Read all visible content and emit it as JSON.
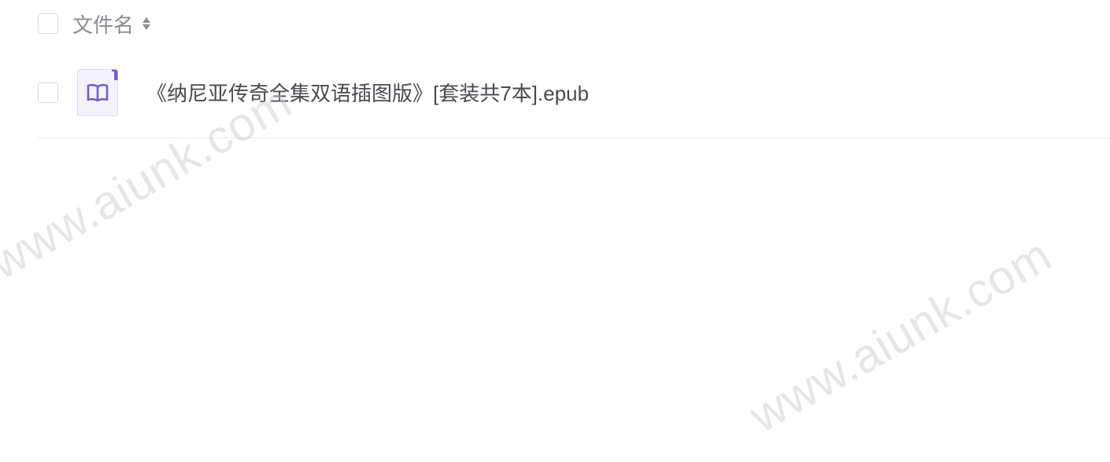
{
  "header": {
    "column_title": "文件名"
  },
  "files": [
    {
      "name": "《纳尼亚传奇全集双语插图版》[套装共7本].epub",
      "icon": "book-icon"
    }
  ],
  "watermarks": [
    "www.aiunk.com",
    "www.aiunk.com"
  ],
  "colors": {
    "icon_accent": "#6b5fd6",
    "icon_bg": "#f4f3fb",
    "text": "#4a4a52",
    "header_text": "#8b8b92"
  }
}
